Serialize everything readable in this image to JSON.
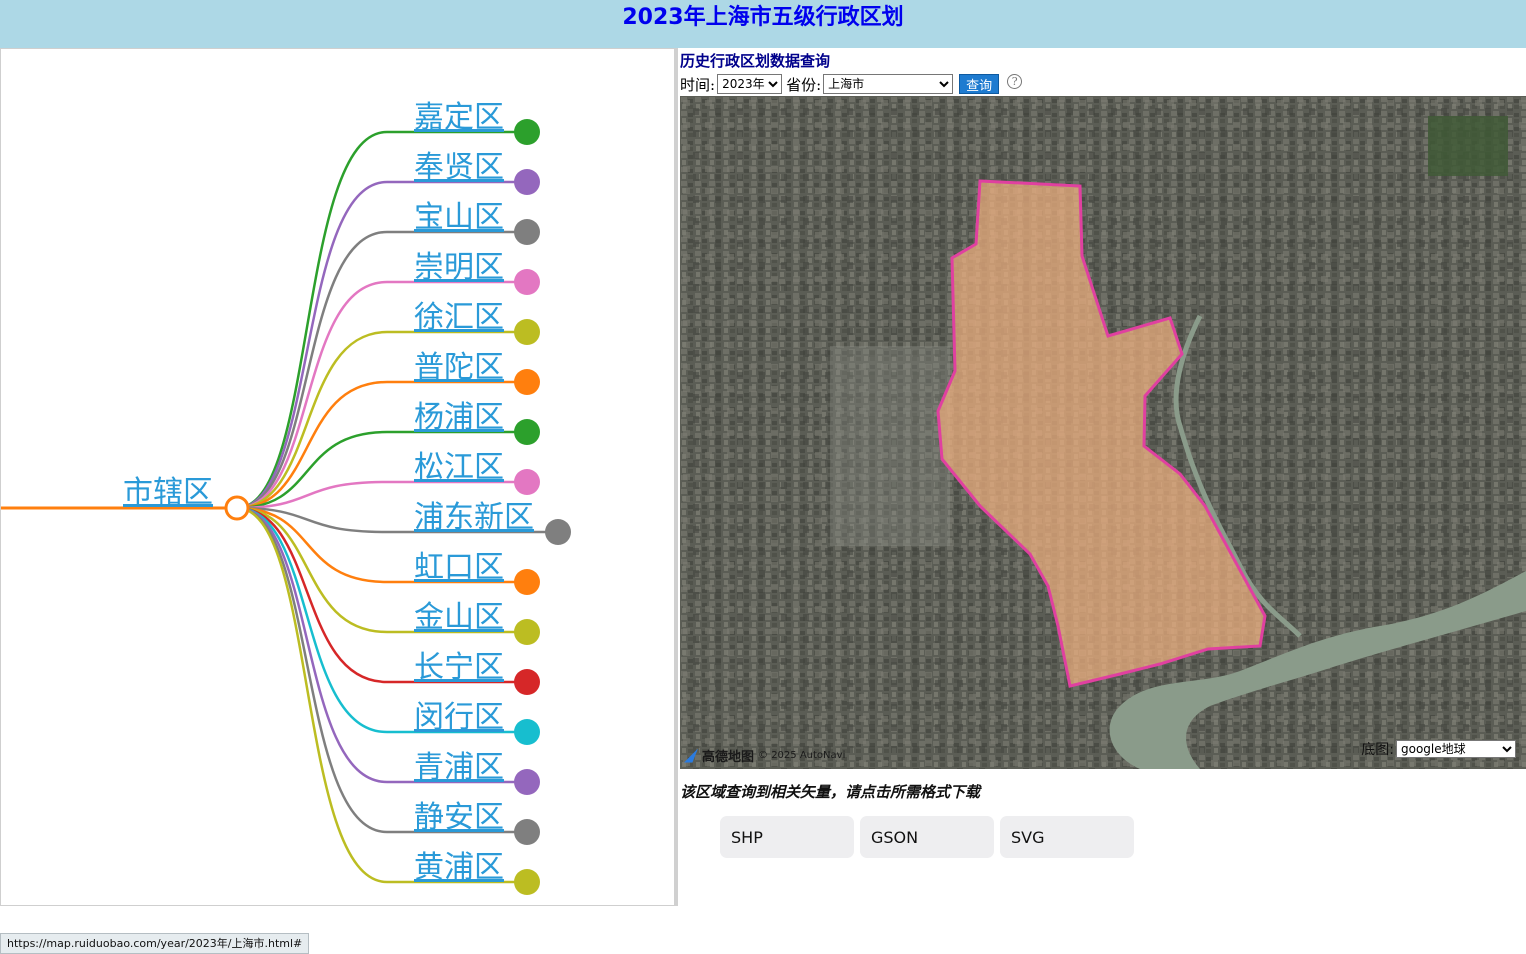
{
  "header": {
    "title": "2023年上海市五级行政区划"
  },
  "tree": {
    "root_label": "市辖区",
    "branches": [
      {
        "label": "嘉定区",
        "color": "#2ca02c"
      },
      {
        "label": "奉贤区",
        "color": "#9467bd"
      },
      {
        "label": "宝山区",
        "color": "#7f7f7f"
      },
      {
        "label": "崇明区",
        "color": "#e377c2"
      },
      {
        "label": "徐汇区",
        "color": "#bcbd22"
      },
      {
        "label": "普陀区",
        "color": "#ff7f0e"
      },
      {
        "label": "杨浦区",
        "color": "#2ca02c"
      },
      {
        "label": "松江区",
        "color": "#e377c2"
      },
      {
        "label": "浦东新区",
        "color": "#7f7f7f"
      },
      {
        "label": "虹口区",
        "color": "#ff7f0e"
      },
      {
        "label": "金山区",
        "color": "#bcbd22"
      },
      {
        "label": "长宁区",
        "color": "#d62728"
      },
      {
        "label": "闵行区",
        "color": "#17becf"
      },
      {
        "label": "青浦区",
        "color": "#9467bd"
      },
      {
        "label": "静安区",
        "color": "#7f7f7f"
      },
      {
        "label": "黄浦区",
        "color": "#bcbd22"
      }
    ],
    "root_color": "#ff7f0e",
    "link_color": "#2a9ad8"
  },
  "query": {
    "title": "历史行政区划数据查询",
    "time_label": "时间:",
    "time_value": "2023年",
    "province_label": "省份:",
    "province_value": "上海市",
    "button_label": "查询",
    "help_symbol": "?"
  },
  "map": {
    "logo_text": "高德地图",
    "copyright": "© 2025 AutoNavi",
    "basemap_label": "底图:",
    "basemap_value": "google地球",
    "highlight_fill": "#f0b080",
    "highlight_stroke": "#e040a0"
  },
  "download": {
    "note": "该区域查询到相关矢量，请点击所需格式下载",
    "buttons": [
      "SHP",
      "GSON",
      "SVG"
    ]
  },
  "status": {
    "url": "https://map.ruiduobao.com/year/2023年/上海市.html#"
  }
}
